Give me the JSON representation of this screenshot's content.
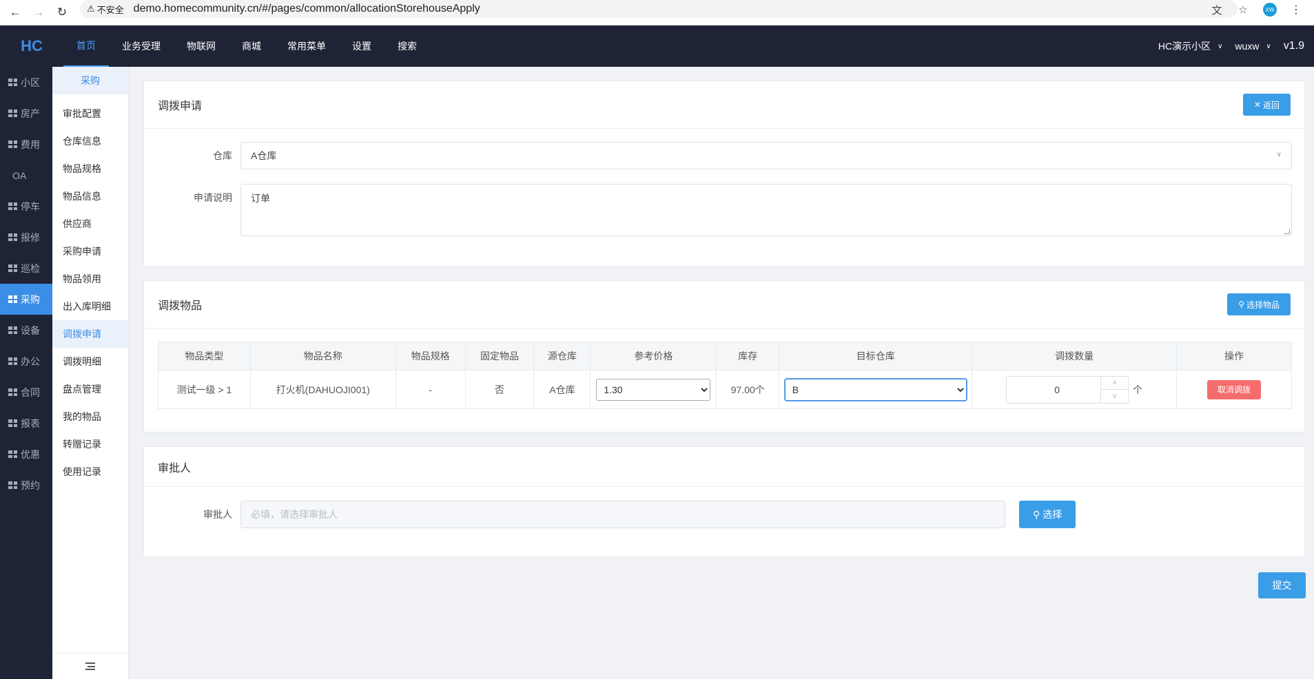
{
  "browser": {
    "security_label": "不安全",
    "url": "demo.homecommunity.cn/#/pages/common/allocationStorehouseApply",
    "profile_initials": "XW"
  },
  "header": {
    "logo": "HC",
    "menu": [
      "首页",
      "业务受理",
      "物联网",
      "商城",
      "常用菜单",
      "设置",
      "搜索"
    ],
    "community": "HC演示小区",
    "user": "wuxw",
    "version": "v1.9"
  },
  "rail": {
    "items": [
      "小区",
      "房产",
      "费用",
      "OA",
      "停车",
      "报修",
      "巡检",
      "采购",
      "设备",
      "办公",
      "合同",
      "报表",
      "优惠",
      "预约"
    ]
  },
  "submenu": {
    "title": "采购",
    "items": [
      "审批配置",
      "仓库信息",
      "物品规格",
      "物品信息",
      "供应商",
      "采购申请",
      "物品领用",
      "出入库明细",
      "调拨申请",
      "调拨明细",
      "盘点管理",
      "我的物品",
      "转赠记录",
      "使用记录"
    ]
  },
  "apply_panel": {
    "title": "调拨申请",
    "back_label": "返回",
    "warehouse_label": "仓库",
    "warehouse_value": "A仓库",
    "desc_label": "申请说明",
    "desc_value": "订单"
  },
  "items_panel": {
    "title": "调拨物品",
    "select_label": "选择物品",
    "columns": [
      "物品类型",
      "物品名称",
      "物品规格",
      "固定物品",
      "源仓库",
      "参考价格",
      "库存",
      "目标仓库",
      "调拨数量",
      "操作"
    ],
    "row": {
      "type": "测试一级 > 1",
      "name": "打火机(DAHUOJI001)",
      "spec": "-",
      "fixed": "否",
      "source": "A仓库",
      "price": "1.30",
      "stock": "97.00个",
      "target": "B",
      "quantity": "0",
      "unit": "个",
      "cancel_label": "取消调拨"
    }
  },
  "approver_panel": {
    "title": "审批人",
    "label": "审批人",
    "placeholder": "必填，请选择审批人",
    "select_label": "选择"
  },
  "submit_label": "提交"
}
